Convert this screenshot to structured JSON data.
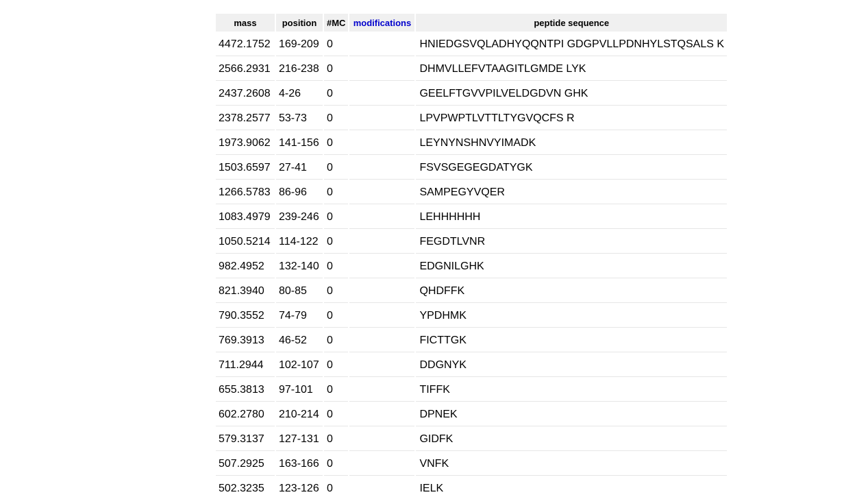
{
  "table": {
    "headers": {
      "mass": "mass",
      "position": "position",
      "mc": "#MC",
      "modifications": "modifications",
      "sequence": "peptide sequence"
    },
    "rows": [
      {
        "mass": "4472.1752",
        "position": "169-209",
        "mc": "0",
        "mods": "",
        "sequence": "HNIEDGSVQLADHYQQNTPI GDGPVLLPDNHYLSTQSALS K"
      },
      {
        "mass": "2566.2931",
        "position": "216-238",
        "mc": "0",
        "mods": "",
        "sequence": "DHMVLLEFVTAAGITLGMDE LYK"
      },
      {
        "mass": "2437.2608",
        "position": "4-26",
        "mc": "0",
        "mods": "",
        "sequence": "GEELFTGVVPILVELDGDVN GHK"
      },
      {
        "mass": "2378.2577",
        "position": "53-73",
        "mc": "0",
        "mods": "",
        "sequence": "LPVPWPTLVTTLTYGVQCFS R"
      },
      {
        "mass": "1973.9062",
        "position": "141-156",
        "mc": "0",
        "mods": "",
        "sequence": "LEYNYNSHNVYIMADK"
      },
      {
        "mass": "1503.6597",
        "position": "27-41",
        "mc": "0",
        "mods": "",
        "sequence": "FSVSGEGEGDATYGK"
      },
      {
        "mass": "1266.5783",
        "position": "86-96",
        "mc": "0",
        "mods": "",
        "sequence": "SAMPEGYVQER"
      },
      {
        "mass": "1083.4979",
        "position": "239-246",
        "mc": "0",
        "mods": "",
        "sequence": "LEHHHHHH"
      },
      {
        "mass": "1050.5214",
        "position": "114-122",
        "mc": "0",
        "mods": "",
        "sequence": "FEGDTLVNR"
      },
      {
        "mass": "982.4952",
        "position": "132-140",
        "mc": "0",
        "mods": "",
        "sequence": "EDGNILGHK"
      },
      {
        "mass": "821.3940",
        "position": "80-85",
        "mc": "0",
        "mods": "",
        "sequence": "QHDFFK"
      },
      {
        "mass": "790.3552",
        "position": "74-79",
        "mc": "0",
        "mods": "",
        "sequence": "YPDHMK"
      },
      {
        "mass": "769.3913",
        "position": "46-52",
        "mc": "0",
        "mods": "",
        "sequence": "FICTTGK"
      },
      {
        "mass": "711.2944",
        "position": "102-107",
        "mc": "0",
        "mods": "",
        "sequence": "DDGNYK"
      },
      {
        "mass": "655.3813",
        "position": "97-101",
        "mc": "0",
        "mods": "",
        "sequence": "TIFFK"
      },
      {
        "mass": "602.2780",
        "position": "210-214",
        "mc": "0",
        "mods": "",
        "sequence": "DPNEK"
      },
      {
        "mass": "579.3137",
        "position": "127-131",
        "mc": "0",
        "mods": "",
        "sequence": "GIDFK"
      },
      {
        "mass": "507.2925",
        "position": "163-166",
        "mc": "0",
        "mods": "",
        "sequence": "VNFK"
      },
      {
        "mass": "502.3235",
        "position": "123-126",
        "mc": "0",
        "mods": "",
        "sequence": "IELK"
      }
    ]
  }
}
